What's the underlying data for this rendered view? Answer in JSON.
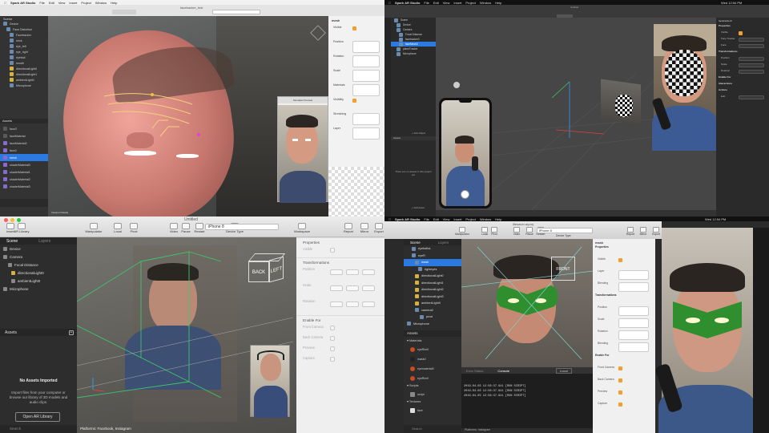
{
  "q1": {
    "menu": [
      "Spark AR Studio",
      "File",
      "Edit",
      "View",
      "Insert",
      "Project",
      "Window",
      "Help"
    ],
    "title": "facetracker_test",
    "tree": [
      "Scene",
      "Device",
      "Face Distortion",
      "Facetracker",
      "neck",
      "eye_left",
      "eye_right",
      "eyeball",
      "mouth",
      "directionalLight0",
      "directionalLight1",
      "ambientLight0",
      "Microphone"
    ],
    "assets_header": "Assets",
    "assets": [
      "face3",
      "faceMaterial",
      "faceMaterial2",
      "face2",
      "mesh",
      "shaderMaterial0",
      "shaderMaterial1",
      "shaderMaterial2",
      "shaderMaterial3"
    ],
    "inspector_title": "mesh",
    "inspector": [
      "Visible",
      "Position",
      "Rotation",
      "Scale",
      "Materials",
      "Visibility",
      "Stretching",
      "Layer"
    ],
    "preview_label": "Simulator Preview",
    "status": "Viewport Ready"
  },
  "q2": {
    "menu": [
      "Spark AR Studio",
      "File",
      "Edit",
      "View",
      "Insert",
      "Project",
      "Window",
      "Help"
    ],
    "clock": "Wed 12:54 PM",
    "title": "Untitled",
    "tree": [
      "Scene",
      "Device",
      "Camera",
      "Focal Distance",
      "facetracker0",
      "faceMesh0",
      "planeTracker",
      "Microphone"
    ],
    "assets_header": "Assets",
    "no_assets": "There are no assets in this project yet",
    "add_object": "+ Add Object",
    "add_asset": "+ Add Asset",
    "inspector_title": "facetracker0",
    "inspector": [
      "Properties",
      "Visible",
      "Face Tracker",
      "Face",
      "Transformations",
      "Position",
      "Scale",
      "Rotation",
      "Enable For",
      "Interactions",
      "Actions",
      "Edit"
    ],
    "edit_button": "Edit"
  },
  "q3": {
    "title": "Untitled",
    "toolbar": [
      "Insert",
      "AR Library",
      "Manipulator",
      "Local",
      "Pivot",
      "Video",
      "Pause",
      "Restart",
      "Device Type",
      "Workspace",
      "Report",
      "Mirror",
      "Export"
    ],
    "device": "iPhone 8",
    "tabs": [
      "Scene",
      "Layers"
    ],
    "tree": [
      "Device",
      "Camera",
      "Focal Distance",
      "directionalLight0",
      "ambientLight0",
      "Microphone"
    ],
    "assets_header": "Assets",
    "no_assets_title": "No Assets Imported",
    "no_assets_body": "Import files from your computer or browse our library of 3D models and audio clips.",
    "open_library": "Open AR Library",
    "search": "Search",
    "cube_back": "BACK",
    "cube_left": "LEFT",
    "platforms": "Platforms: Facebook, Instagram",
    "inspector_sections": [
      "Properties",
      "Transformations",
      "Enable For"
    ],
    "inspector_fields": [
      "Visible",
      "Position",
      "Scale",
      "Rotation",
      "Front Camera",
      "Back Camera",
      "Preview",
      "Capture"
    ]
  },
  "q4": {
    "menu": [
      "Spark AR Studio",
      "File",
      "Edit",
      "View",
      "Insert",
      "Project",
      "Window",
      "Help"
    ],
    "clock": "Wed 12:54 PM",
    "title": "lifesaver.arproj",
    "toolbar": [
      "Manipulator",
      "Local",
      "Pivot",
      "Video",
      "Pause",
      "Restart",
      "Device Type",
      "Report",
      "Mirror",
      "Export"
    ],
    "device": "iPhone 8",
    "tabs": [
      "Scene",
      "Layers"
    ],
    "tree": [
      "eyeballsL",
      "eyeR",
      "mask",
      "righteyes",
      "directionalLight0",
      "directionalLight1",
      "directionalLight2",
      "directionalLight3",
      "ambientLight0",
      "camera0",
      "pivot",
      "Microphone"
    ],
    "assets_header": "Assets",
    "asset_groups": [
      "Materials",
      "Scripts",
      "Textures"
    ],
    "materials": [
      "eyeRim0",
      "mask0",
      "eyematerial0",
      "eyeRim0"
    ],
    "scripts": [
      "script"
    ],
    "textures": [
      "face"
    ],
    "front_label": "FRONT",
    "console_tabs": [
      "Error Status",
      "Console"
    ],
    "console_lines": [
      "2019-04-03 12:56:37.941 [RUN SCRIPT]",
      "2019-04-03 12:56:37.941 [RUN SCRIPT]",
      "2019-04-03 12:56:37.941 [RUN SCRIPT]"
    ],
    "local": "Local",
    "search": "Search",
    "platforms": "Platforms: Instagram",
    "inspector_title": "mask",
    "inspector": [
      "Properties",
      "Visible",
      "Layer",
      "Blending",
      "Transformations",
      "Position",
      "Scale",
      "Rotation",
      "Blending",
      "Enable For",
      "Front Camera",
      "Back Camera",
      "Preview",
      "Capture"
    ]
  },
  "colors": {
    "accent": "#2a7ae2",
    "check": "#f0a030",
    "mask_green": "#2f8f2f",
    "wire_green": "#3ec46d"
  }
}
